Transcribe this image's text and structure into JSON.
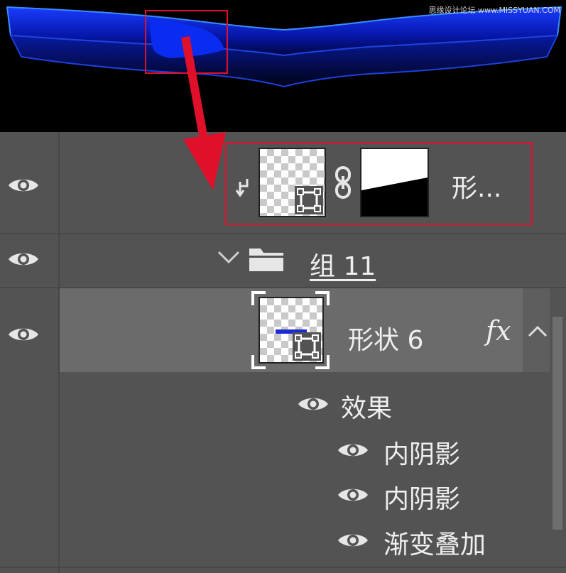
{
  "canvas": {
    "watermark": "思缘设计论坛 www.MISSYUAN.COM"
  },
  "layers_panel": {
    "layers": [
      {
        "name": "形...",
        "visible": true,
        "clipped": true,
        "has_mask": true,
        "icon": "clipping-arrow-icon"
      },
      {
        "name": "组 11",
        "visible": true,
        "type": "group",
        "expanded": true,
        "icon": "folder-icon"
      },
      {
        "name": "形状 6",
        "visible": true,
        "selected": true,
        "fx_label": "fx",
        "icon": "vector-shape-icon"
      }
    ],
    "effects_header": "效果",
    "effects": [
      {
        "name": "内阴影",
        "visible": true
      },
      {
        "name": "内阴影",
        "visible": true
      },
      {
        "name": "渐变叠加",
        "visible": true
      }
    ]
  },
  "colors": {
    "panel_bg": "#535353",
    "selected_row": "#6b6b6b",
    "annotation_red": "#e0102a",
    "canvas_blue": "#0a2cf0"
  }
}
